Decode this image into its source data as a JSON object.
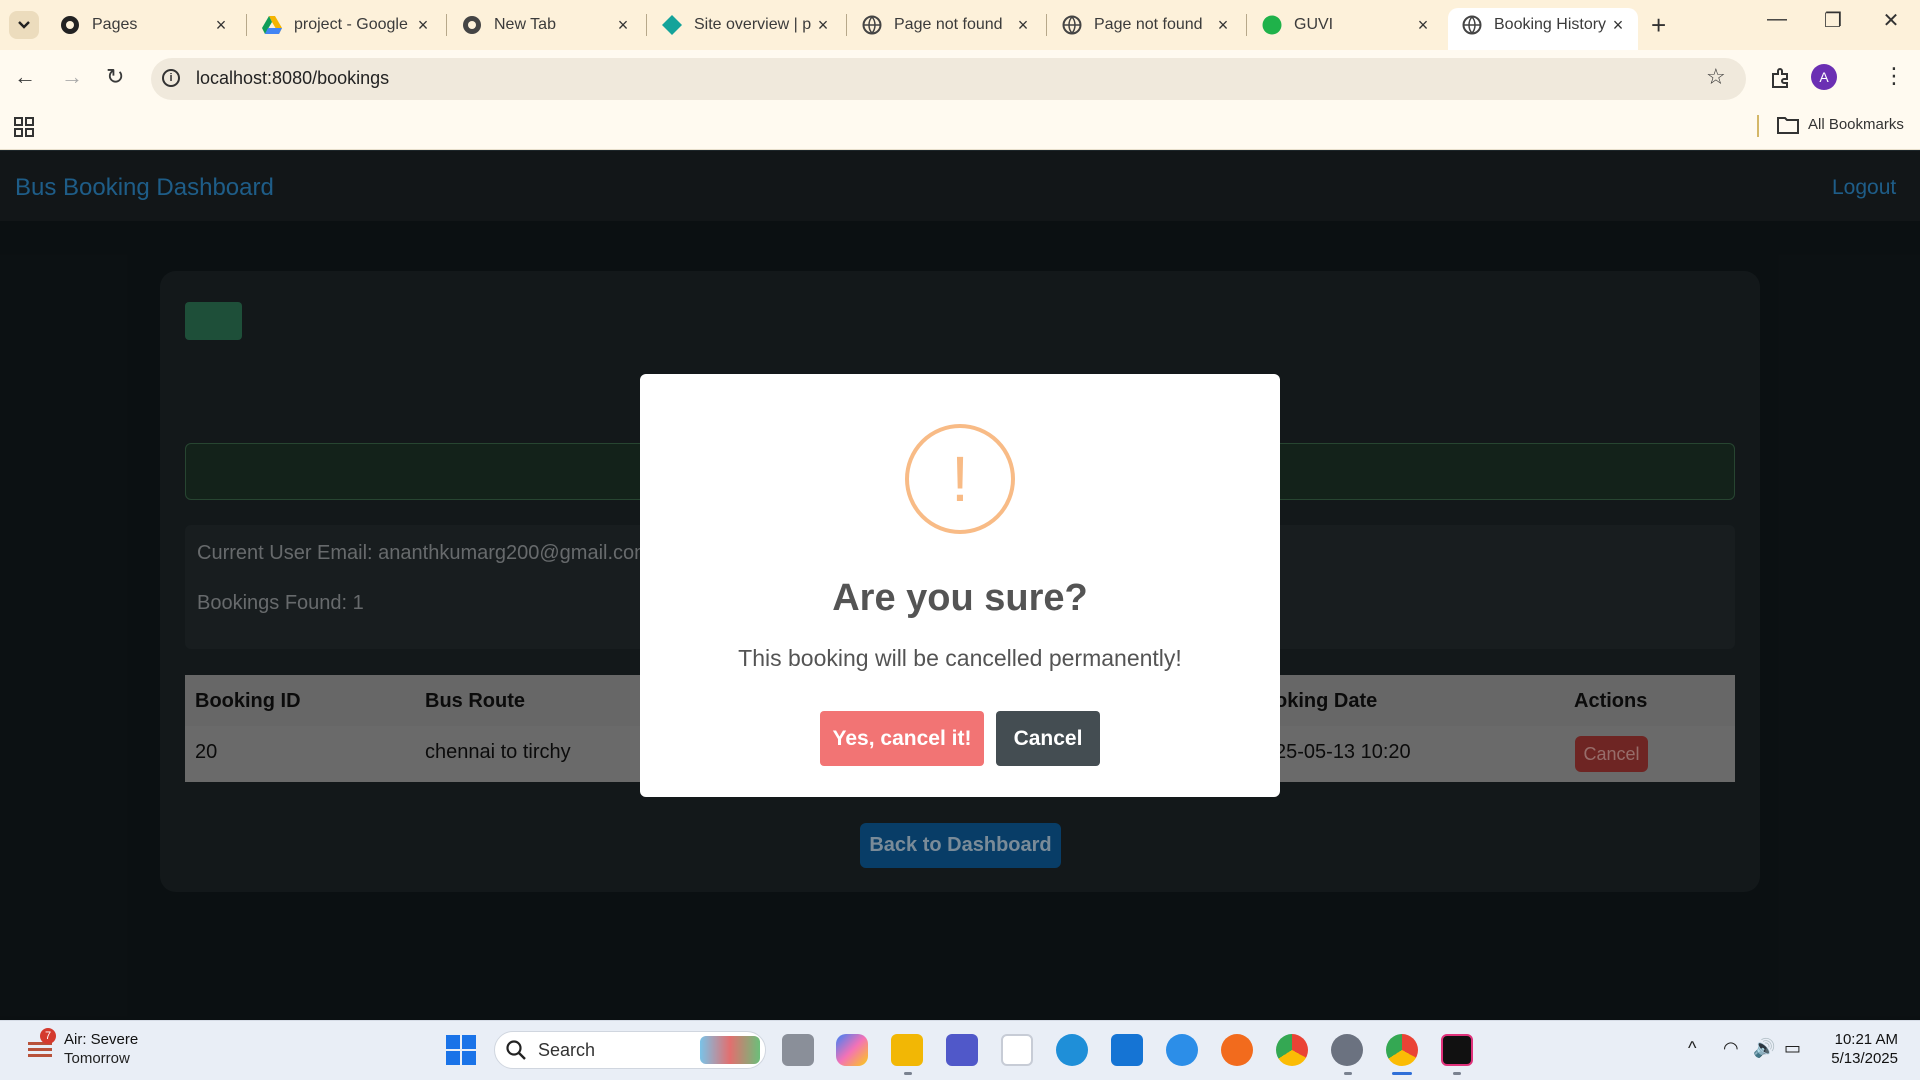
{
  "browser": {
    "tabs": [
      {
        "title": "Pages"
      },
      {
        "title": "project - Google"
      },
      {
        "title": "New Tab"
      },
      {
        "title": "Site overview | p"
      },
      {
        "title": "Page not found"
      },
      {
        "title": "Page not found"
      },
      {
        "title": "GUVI"
      },
      {
        "title": "Booking History"
      }
    ],
    "url": "localhost:8080/bookings",
    "bookmarks_label": "All Bookmarks",
    "profile_initial": "A"
  },
  "navbar": {
    "brand": "Bus Booking Dashboard",
    "logout": "Logout"
  },
  "info": {
    "email_line": "Current User Email: ananthkumarg200@gmail.com",
    "count_line": "Bookings Found: 1"
  },
  "table": {
    "headers": {
      "booking_id": "Booking ID",
      "bus_route": "Bus Route",
      "booking_date": "oking Date",
      "actions": "Actions"
    },
    "rows": [
      {
        "booking_id": "20",
        "bus_route": "chennai to tirchy",
        "booking_date": "25-05-13 10:20",
        "action": "Cancel"
      }
    ]
  },
  "back_button": "Back to Dashboard",
  "modal": {
    "icon": "!",
    "title": "Are you sure?",
    "text": "This booking will be cancelled permanently!",
    "confirm": "Yes, cancel it!",
    "cancel": "Cancel",
    "colors": {
      "confirm": "#f27474",
      "cancel": "#444d52",
      "warning": "#f8bb86"
    }
  },
  "taskbar": {
    "weather_title": "Air: Severe",
    "weather_sub": "Tomorrow",
    "weather_badge": "7",
    "search": "Search",
    "time": "10:21 AM",
    "date": "5/13/2025"
  }
}
